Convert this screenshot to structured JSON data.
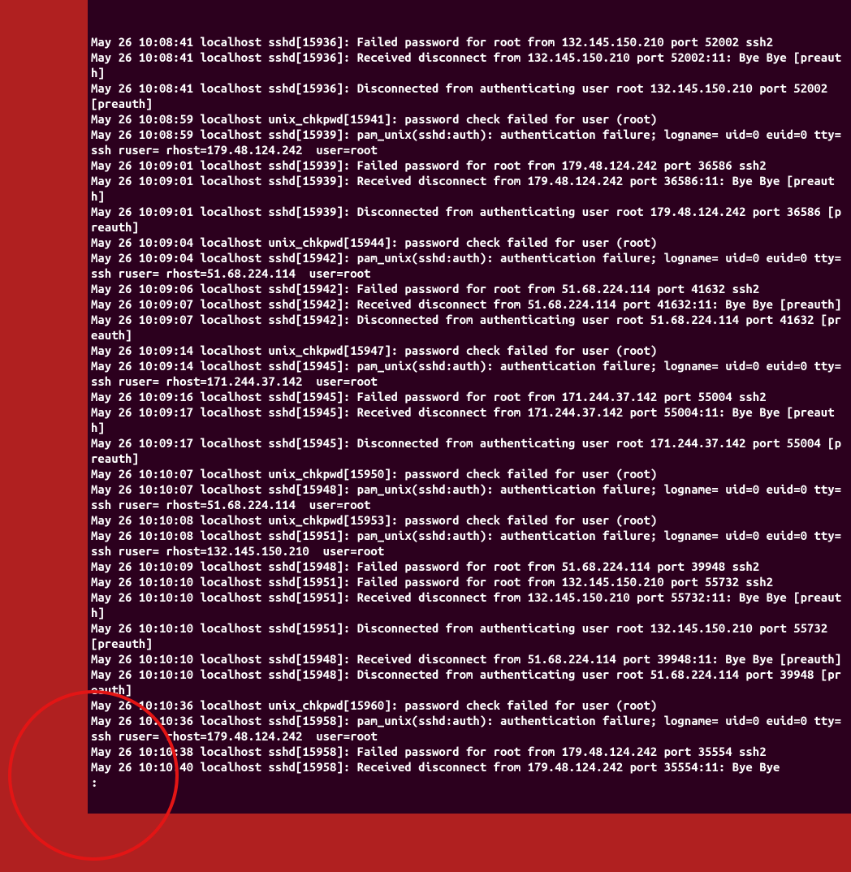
{
  "terminal": {
    "lines": [
      "May 26 10:08:41 localhost sshd[15936]: Failed password for root from 132.145.150.210 port 52002 ssh2",
      "May 26 10:08:41 localhost sshd[15936]: Received disconnect from 132.145.150.210 port 52002:11: Bye Bye [preauth]",
      "May 26 10:08:41 localhost sshd[15936]: Disconnected from authenticating user root 132.145.150.210 port 52002 [preauth]",
      "May 26 10:08:59 localhost unix_chkpwd[15941]: password check failed for user (root)",
      "May 26 10:08:59 localhost sshd[15939]: pam_unix(sshd:auth): authentication failure; logname= uid=0 euid=0 tty=ssh ruser= rhost=179.48.124.242  user=root",
      "May 26 10:09:01 localhost sshd[15939]: Failed password for root from 179.48.124.242 port 36586 ssh2",
      "May 26 10:09:01 localhost sshd[15939]: Received disconnect from 179.48.124.242 port 36586:11: Bye Bye [preauth]",
      "May 26 10:09:01 localhost sshd[15939]: Disconnected from authenticating user root 179.48.124.242 port 36586 [preauth]",
      "May 26 10:09:04 localhost unix_chkpwd[15944]: password check failed for user (root)",
      "May 26 10:09:04 localhost sshd[15942]: pam_unix(sshd:auth): authentication failure; logname= uid=0 euid=0 tty=ssh ruser= rhost=51.68.224.114  user=root",
      "May 26 10:09:06 localhost sshd[15942]: Failed password for root from 51.68.224.114 port 41632 ssh2",
      "May 26 10:09:07 localhost sshd[15942]: Received disconnect from 51.68.224.114 port 41632:11: Bye Bye [preauth]",
      "May 26 10:09:07 localhost sshd[15942]: Disconnected from authenticating user root 51.68.224.114 port 41632 [preauth]",
      "May 26 10:09:14 localhost unix_chkpwd[15947]: password check failed for user (root)",
      "May 26 10:09:14 localhost sshd[15945]: pam_unix(sshd:auth): authentication failure; logname= uid=0 euid=0 tty=ssh ruser= rhost=171.244.37.142  user=root",
      "May 26 10:09:16 localhost sshd[15945]: Failed password for root from 171.244.37.142 port 55004 ssh2",
      "May 26 10:09:17 localhost sshd[15945]: Received disconnect from 171.244.37.142 port 55004:11: Bye Bye [preauth]",
      "May 26 10:09:17 localhost sshd[15945]: Disconnected from authenticating user root 171.244.37.142 port 55004 [preauth]",
      "May 26 10:10:07 localhost unix_chkpwd[15950]: password check failed for user (root)",
      "May 26 10:10:07 localhost sshd[15948]: pam_unix(sshd:auth): authentication failure; logname= uid=0 euid=0 tty=ssh ruser= rhost=51.68.224.114  user=root",
      "May 26 10:10:08 localhost unix_chkpwd[15953]: password check failed for user (root)",
      "May 26 10:10:08 localhost sshd[15951]: pam_unix(sshd:auth): authentication failure; logname= uid=0 euid=0 tty=ssh ruser= rhost=132.145.150.210  user=root",
      "May 26 10:10:09 localhost sshd[15948]: Failed password for root from 51.68.224.114 port 39948 ssh2",
      "May 26 10:10:10 localhost sshd[15951]: Failed password for root from 132.145.150.210 port 55732 ssh2",
      "May 26 10:10:10 localhost sshd[15951]: Received disconnect from 132.145.150.210 port 55732:11: Bye Bye [preauth]",
      "May 26 10:10:10 localhost sshd[15951]: Disconnected from authenticating user root 132.145.150.210 port 55732 [preauth]",
      "May 26 10:10:10 localhost sshd[15948]: Received disconnect from 51.68.224.114 port 39948:11: Bye Bye [preauth]",
      "May 26 10:10:10 localhost sshd[15948]: Disconnected from authenticating user root 51.68.224.114 port 39948 [preauth]",
      "May 26 10:10:36 localhost unix_chkpwd[15960]: password check failed for user (root)",
      "May 26 10:10:36 localhost sshd[15958]: pam_unix(sshd:auth): authentication failure; logname= uid=0 euid=0 tty=ssh ruser= rhost=179.48.124.242  user=root",
      "May 26 10:10:38 localhost sshd[15958]: Failed password for root from 179.48.124.242 port 35554 ssh2",
      "May 26 10:10:40 localhost sshd[15958]: Received disconnect from 179.48.124.242 port 35554:11: Bye Bye",
      ":"
    ]
  }
}
